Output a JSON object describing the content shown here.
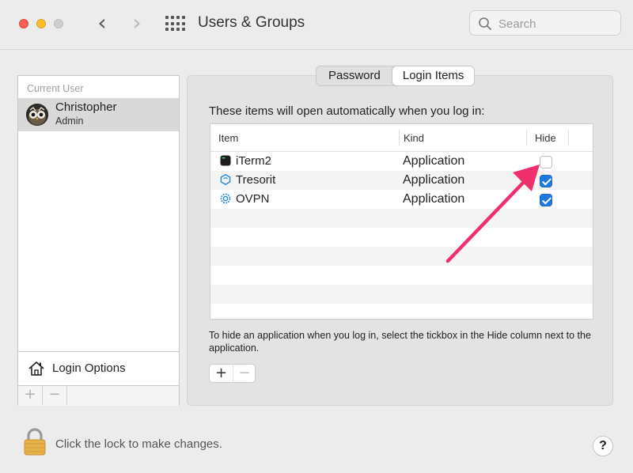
{
  "window": {
    "title": "Users & Groups",
    "search_placeholder": "Search"
  },
  "users_panel": {
    "section_label": "Current User",
    "current_user": {
      "name": "Christopher",
      "role": "Admin"
    },
    "login_options_label": "Login Options",
    "add_symbol": "+",
    "remove_symbol": "−"
  },
  "tabs": [
    {
      "label": "Password",
      "active": false
    },
    {
      "label": "Login Items",
      "active": true
    }
  ],
  "login_items": {
    "intro": "These items will open automatically when you log in:",
    "columns": {
      "item": "Item",
      "kind": "Kind",
      "hide": "Hide"
    },
    "rows": [
      {
        "name": "iTerm2",
        "kind": "Application",
        "hide": false,
        "icon": "iterm2-icon"
      },
      {
        "name": "Tresorit",
        "kind": "Application",
        "hide": true,
        "icon": "tresorit-icon"
      },
      {
        "name": "OVPN",
        "kind": "Application",
        "hide": true,
        "icon": "ovpn-icon"
      }
    ],
    "hint": "To hide an application when you log in, select the tickbox in the Hide column next to the application.",
    "add_symbol": "+",
    "remove_symbol": "−"
  },
  "footer": {
    "lock_text": "Click the lock to make changes.",
    "help_symbol": "?"
  },
  "colors": {
    "accent": "#1f7ae0",
    "annotation_arrow": "#f0306c"
  }
}
